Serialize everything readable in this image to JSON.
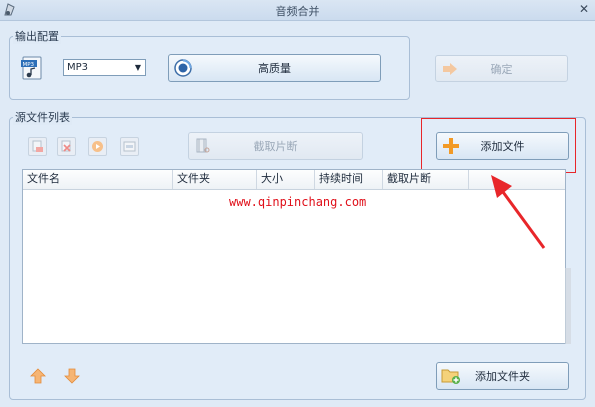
{
  "window": {
    "title": "音频合并"
  },
  "output_settings": {
    "group_title": "输出配置",
    "format_value": "MP3",
    "quality_label": "高质量",
    "confirm_label": "确定"
  },
  "source_list": {
    "group_title": "源文件列表",
    "clip_label": "截取片断",
    "add_file_label": "添加文件",
    "add_folder_label": "添加文件夹",
    "columns": [
      "文件名",
      "文件夹",
      "大小",
      "持续时间",
      "截取片断"
    ],
    "watermark": "www.qinpinchang.com"
  },
  "colors": {
    "highlight": "#e8262a",
    "accent_orange": "#f29a26"
  }
}
